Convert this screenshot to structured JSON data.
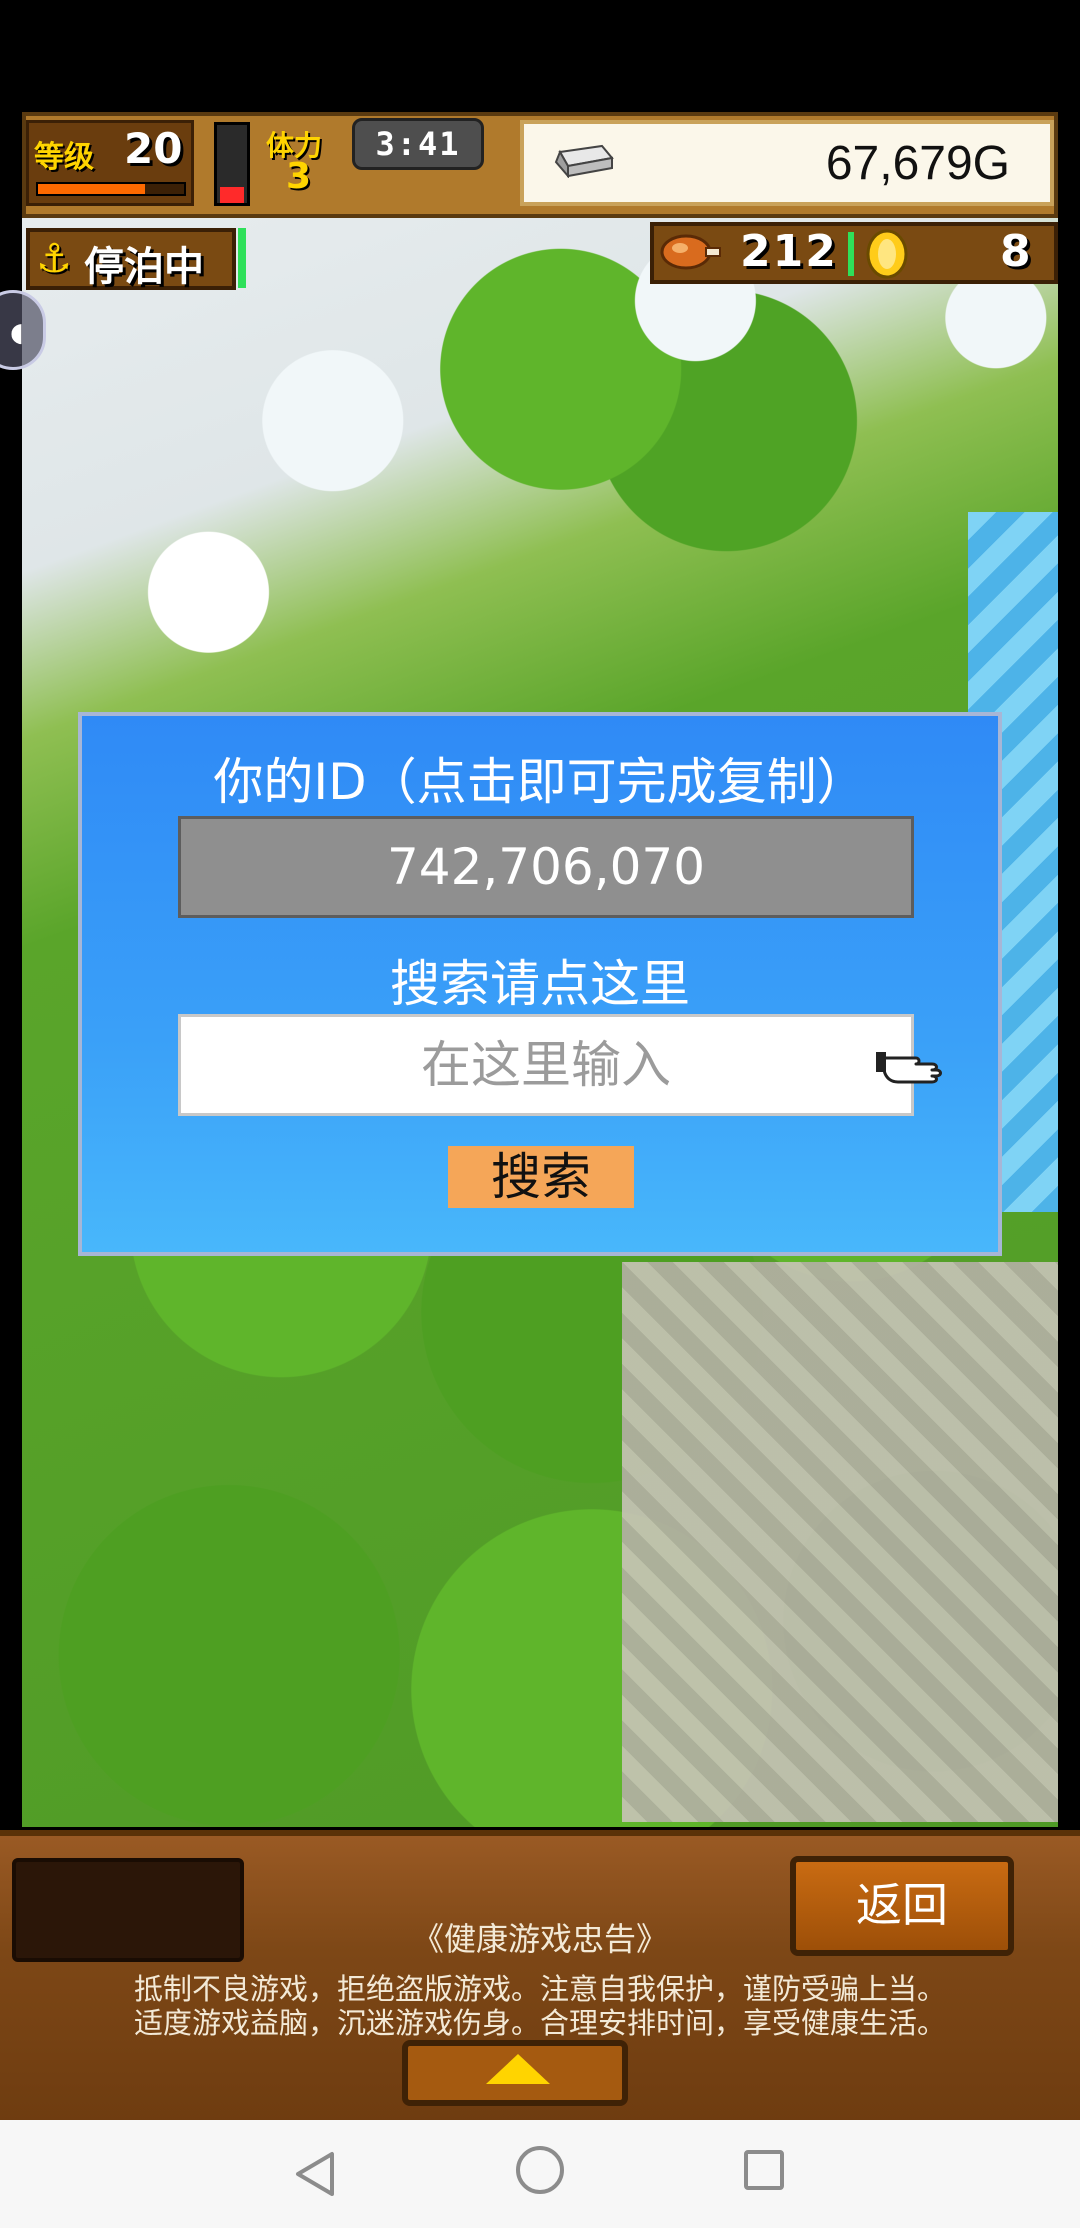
{
  "hud": {
    "level_label": "等级",
    "level_value": "20",
    "level_progress": 0.73,
    "stamina_label": "体力",
    "stamina_value": "3",
    "stamina_level": 0.2,
    "clock": "3:41",
    "gold": "67,679G",
    "status_label": "停泊中",
    "food_value": "212",
    "coin_value": "8"
  },
  "dialog": {
    "title": "你的ID（点击即可完成复制）",
    "id_value": "742,706,070",
    "search_title": "搜索请点这里",
    "search_placeholder": "在这里输入",
    "search_value": "",
    "search_button": "搜索"
  },
  "bottom": {
    "back_button": "返回",
    "notice_title": "《健康游戏忠告》",
    "notice_line1": "抵制不良游戏，拒绝盗版游戏。注意自我保护，谨防受骗上当。",
    "notice_line2": "适度游戏益脑，沉迷游戏伤身。合理安排时间，享受健康生活。"
  },
  "icons": {
    "anchor": "anchor-icon",
    "gold": "silver-bar-icon",
    "food": "meat-icon",
    "coin": "gold-coin-icon",
    "pointer": "pointing-hand-icon",
    "expand": "triangle-up-icon"
  },
  "colors": {
    "dialog_blue": "#2f8af6",
    "search_button": "#f5a658",
    "wood": "#7d4716",
    "hud_gold_text": "#ffd400"
  }
}
